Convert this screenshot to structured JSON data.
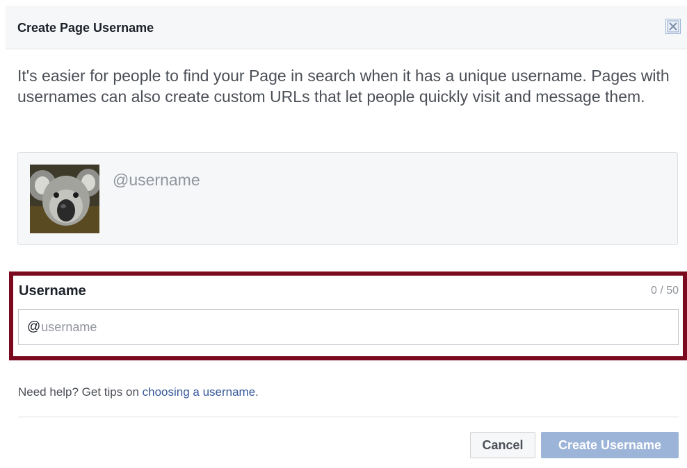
{
  "dialog": {
    "title": "Create Page Username",
    "close_icon": "close-icon"
  },
  "description": "It's easier for people to find your Page in search when it has a unique username. Pages with usernames can also create custom URLs that let people quickly visit and message them.",
  "preview": {
    "avatar_icon": "koala-avatar",
    "username_display": "@username"
  },
  "username_field": {
    "label": "Username",
    "counter": "0 / 50",
    "prefix": "@",
    "value": "",
    "placeholder": "username"
  },
  "help": {
    "text": "Need help? Get tips on ",
    "link_label": "choosing a username",
    "suffix": "."
  },
  "buttons": {
    "cancel_label": "Cancel",
    "create_label": "Create Username"
  },
  "colors": {
    "highlight_frame": "#7b0a1e",
    "link": "#365899",
    "primary_disabled": "#9cb4d8"
  }
}
